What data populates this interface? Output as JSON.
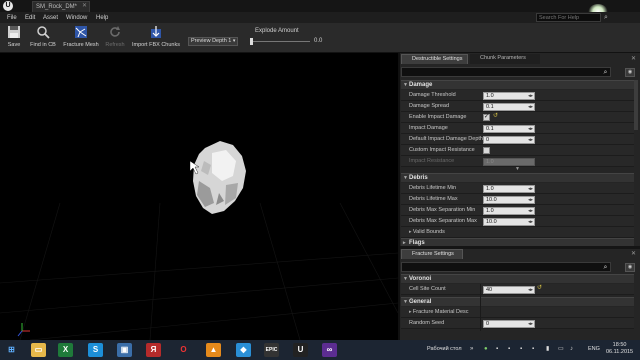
{
  "window": {
    "tab_title": "SM_Rock_DM*",
    "search_help_placeholder": "Search For Help"
  },
  "menu": [
    "File",
    "Edit",
    "Asset",
    "Window",
    "Help"
  ],
  "toolbar": {
    "save": "Save",
    "find_in_cb": "Find in CB",
    "fracture_mesh": "Fracture Mesh",
    "refresh": "Refresh",
    "import_fbx": "Import FBX Chunks",
    "preview_depth": "Preview Depth 1",
    "explode_amount_label": "Explode Amount",
    "explode_amount_value": "0.0",
    "explode_amount_fraction": 0.0
  },
  "panel": {
    "tab_destructible": "Destructible Settings",
    "tab_chunk": "Chunk Parameters",
    "damage": {
      "title": "Damage",
      "damage_threshold_label": "Damage Threshold",
      "damage_threshold_value": "1.0",
      "damage_spread_label": "Damage Spread",
      "damage_spread_value": "0.1",
      "enable_impact_label": "Enable Impact Damage",
      "enable_impact_checked": true,
      "impact_damage_label": "Impact Damage",
      "impact_damage_value": "0.1",
      "default_depth_label": "Default Impact Damage Depth",
      "default_depth_value": "0",
      "custom_resistance_label": "Custom Impact Resistance",
      "custom_resistance_checked": false,
      "impact_resistance_label": "Impact Resistance",
      "impact_resistance_value": "1.0"
    },
    "debris": {
      "title": "Debris",
      "lifetime_min_label": "Debris Lifetime Min",
      "lifetime_min_value": "1.0",
      "lifetime_max_label": "Debris Lifetime Max",
      "lifetime_max_value": "10.0",
      "sep_min_label": "Debris Max Separation Min",
      "sep_min_value": "1.0",
      "sep_max_label": "Debris Max Separation Max",
      "sep_max_value": "10.0",
      "valid_bounds_label": "Valid Bounds",
      "flags_label": "Flags"
    },
    "fracture": {
      "tab": "Fracture Settings",
      "voronoi_title": "Voronoi",
      "cell_site_count_label": "Cell Site Count",
      "cell_site_count_value": "40",
      "general_title": "General",
      "fracture_material_label": "Fracture Material Desc",
      "random_seed_label": "Random Seed",
      "random_seed_value": "0"
    }
  },
  "taskbar": {
    "desktop_label": "Рабочий стол",
    "language": "ENG",
    "time": "18:50",
    "date": "06.11.2015"
  }
}
